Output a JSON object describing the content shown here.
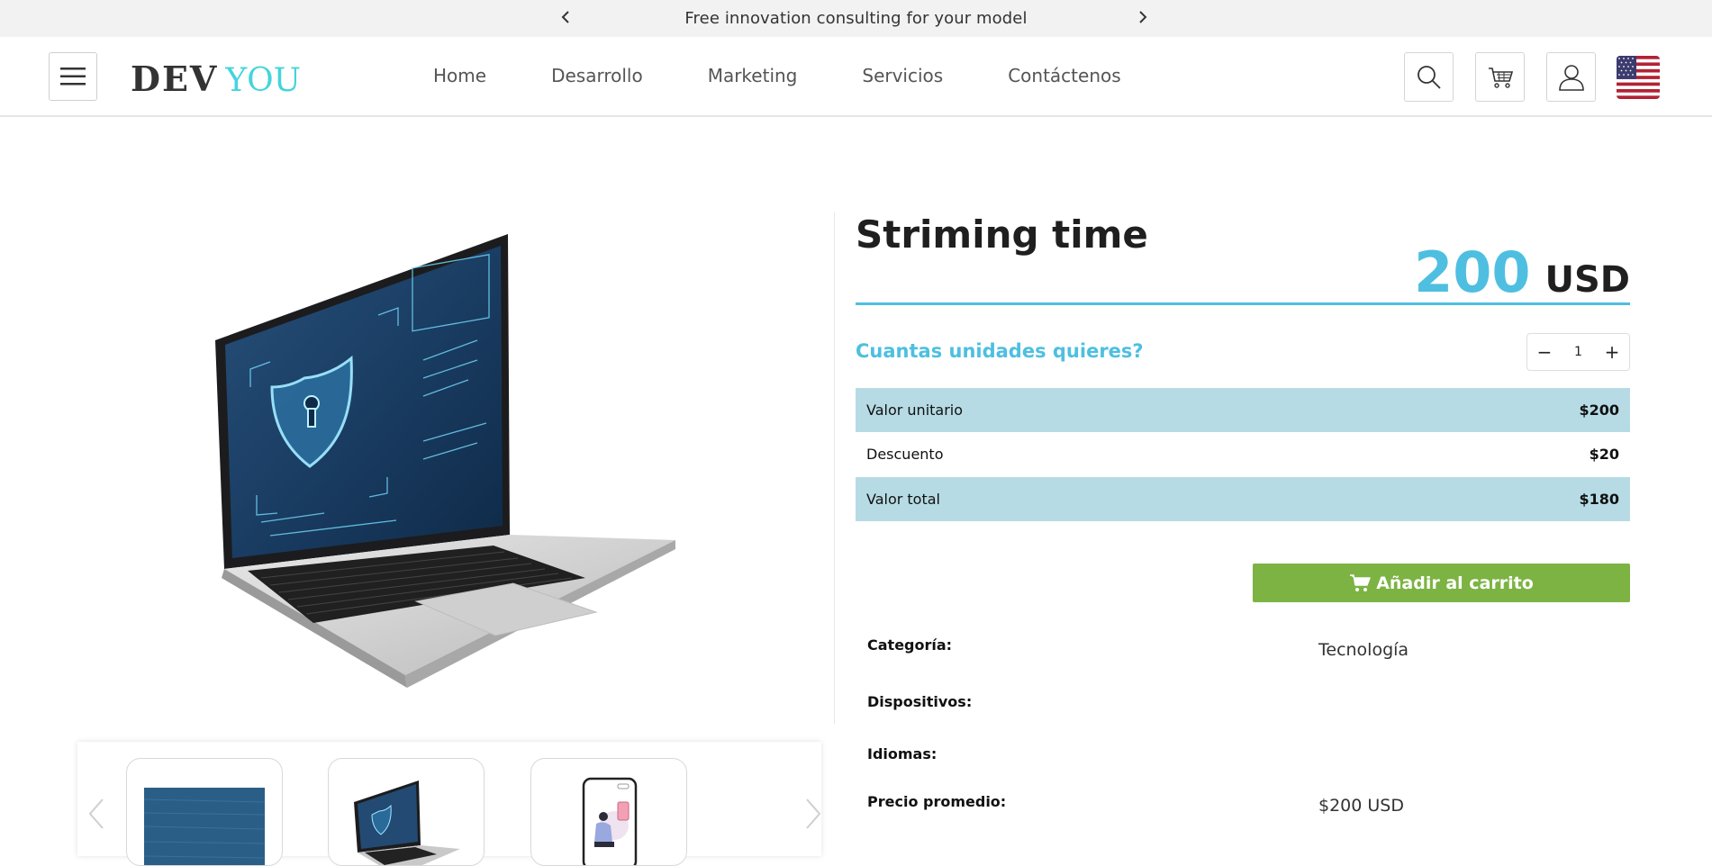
{
  "announcement": {
    "message": "Free innovation consulting for your model"
  },
  "header": {
    "logo_dev": "DEV",
    "logo_you": "YOU",
    "nav": [
      "Home",
      "Desarrollo",
      "Marketing",
      "Servicios",
      "Contáctenos"
    ]
  },
  "product": {
    "title": "Striming time",
    "price_amount": "200",
    "price_currency": "USD",
    "quantity_label": "Cuantas unidades quieres?",
    "quantity": "1",
    "minus": "−",
    "plus": "+",
    "rows": [
      {
        "label": "Valor unitario",
        "value": "$200"
      },
      {
        "label": "Descuento",
        "value": "$20"
      },
      {
        "label": "Valor total",
        "value": "$180"
      }
    ],
    "add_to_cart": "Añadir al carrito",
    "specs": [
      {
        "label": "Categoría:",
        "value": "Tecnología"
      },
      {
        "label": "Dispositivos:",
        "value": ""
      },
      {
        "label": "Idiomas:",
        "value": ""
      },
      {
        "label": "Precio promedio:",
        "value": "$200 USD"
      }
    ]
  },
  "colors": {
    "accent": "#4ebfe0",
    "row_shade": "#b6dbe5",
    "cart_button": "#7cb342",
    "logo_you": "#44d4dc"
  },
  "icons": [
    "chevron-left-icon",
    "chevron-right-icon",
    "hamburger-menu-icon",
    "search-icon",
    "cart-icon",
    "user-icon",
    "us-flag-icon"
  ]
}
